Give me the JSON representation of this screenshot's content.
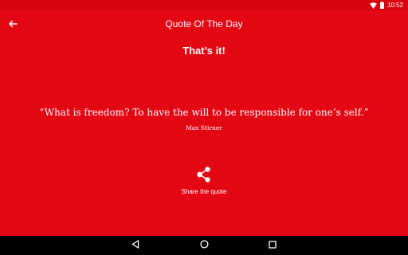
{
  "status_bar": {
    "time": "10:52"
  },
  "toolbar": {
    "title": "Quote Of The Day"
  },
  "main": {
    "heading": "That’s it!",
    "quote_text": "“What is freedom? To have the will to be responsible for one’s self.”",
    "author": "Max Stirner",
    "share_label": "Share the quote"
  },
  "colors": {
    "background": "#e30613",
    "nav_bar": "#000000",
    "text": "#ffffff"
  },
  "icons": {
    "back": "arrow-left-icon",
    "share": "share-icon",
    "wifi": "wifi-icon",
    "battery": "battery-icon",
    "nav_back": "nav-back-icon",
    "nav_home": "nav-home-icon",
    "nav_recents": "nav-recents-icon"
  }
}
